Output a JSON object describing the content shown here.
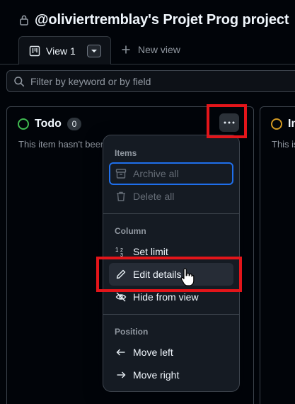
{
  "header": {
    "title": "@oliviertremblay's Projet Prog project"
  },
  "tabs": {
    "active_label": "View 1",
    "new_view_label": "New view"
  },
  "filter": {
    "placeholder": "Filter by keyword or by field"
  },
  "columns": [
    {
      "name": "Todo",
      "count": "0",
      "description": "This item hasn't been started",
      "status_color": "#3fb950"
    },
    {
      "name": "In progress",
      "description": "This is actively being worked on",
      "status_color": "#d29922"
    }
  ],
  "menu": {
    "sections": {
      "items": "Items",
      "column": "Column",
      "position": "Position"
    },
    "items": {
      "archive_all": "Archive all",
      "delete_all": "Delete all",
      "set_limit": "Set limit",
      "edit_details": "Edit details",
      "hide_from_view": "Hide from view",
      "move_left": "Move left",
      "move_right": "Move right"
    }
  },
  "colors": {
    "background": "#010409",
    "accent_focus": "#1f6feb",
    "highlight_box": "#e3151a"
  }
}
